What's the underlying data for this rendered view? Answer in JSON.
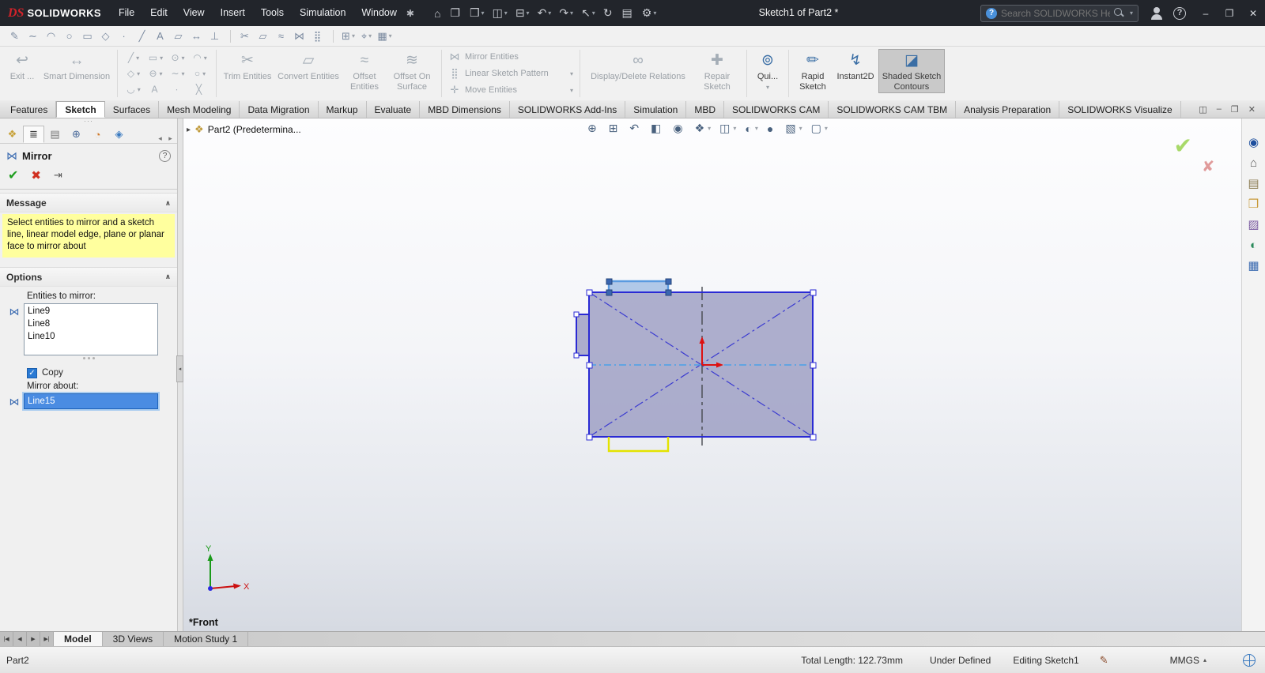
{
  "colors": {
    "titlebar_bg": "#22252b",
    "brand_red": "#d2232a",
    "message_yellow": "#ffff9e",
    "selection_blue": "#4a8ce2",
    "sketch_blue": "#2a2ad4",
    "selected_sketch_blue": "#5a9ae0",
    "preview_yellow": "#e3e300",
    "origin_red": "#dd1111",
    "shaded_fill": "#8a8cb8",
    "confirm_green": "#9fd65a",
    "cancel_red": "#e09a9a"
  },
  "ui": {
    "caret_down": "▾",
    "caret_up": "▴",
    "chevron_up": "∧",
    "grip_dots": "···",
    "collapse_left": "◂",
    "expand_right": "▸",
    "check_glyph": "✓"
  },
  "title_bar": {
    "logo_mark": "DS",
    "logo_text": "SOLIDWORKS",
    "menus": [
      "File",
      "Edit",
      "View",
      "Insert",
      "Tools",
      "Simulation",
      "Window"
    ],
    "pin_icon": "✱",
    "tools": [
      {
        "name": "home-icon",
        "glyph": "⌂"
      },
      {
        "name": "new-document-icon",
        "glyph": "❐"
      },
      {
        "name": "open-document-icon",
        "glyph": "❒",
        "caret": "▾"
      },
      {
        "name": "save-icon",
        "glyph": "◫",
        "caret": "▾"
      },
      {
        "name": "print-icon",
        "glyph": "⊟",
        "caret": "▾"
      },
      {
        "name": "undo-icon",
        "glyph": "↶",
        "caret": "▾"
      },
      {
        "name": "redo-icon",
        "glyph": "↷",
        "caret": "▾"
      },
      {
        "name": "select-icon",
        "glyph": "↖",
        "caret": "▾"
      },
      {
        "name": "rebuild-icon",
        "glyph": "↻"
      },
      {
        "name": "file-properties-icon",
        "glyph": "▤"
      },
      {
        "name": "options-icon",
        "glyph": "⚙",
        "caret": "▾"
      }
    ],
    "document_title": "Sketch1 of Part2 *",
    "search_help_glyph": "?",
    "search_placeholder": "Search SOLIDWORKS Help",
    "help_glyph": "?",
    "window_controls": [
      {
        "name": "minimize-button",
        "glyph": "–"
      },
      {
        "name": "maximize-button",
        "glyph": "❐"
      },
      {
        "name": "close-button",
        "glyph": "✕"
      }
    ]
  },
  "quick_toolbar": {
    "group1": [
      {
        "name": "sketch-tool-icon",
        "glyph": "✎"
      },
      {
        "name": "spline-tool-icon",
        "glyph": "∼"
      },
      {
        "name": "arc-tool-icon",
        "glyph": "◠"
      },
      {
        "name": "circle-tool-icon",
        "glyph": "○"
      },
      {
        "name": "rectangle-tool-icon",
        "glyph": "▭"
      },
      {
        "name": "polygon-tool-icon",
        "glyph": "◇"
      },
      {
        "name": "point-tool-icon",
        "glyph": "∙"
      },
      {
        "name": "centerline-tool-icon",
        "glyph": "╱"
      },
      {
        "name": "text-tool-icon",
        "glyph": "A"
      },
      {
        "name": "plane-tool-icon",
        "glyph": "▱"
      },
      {
        "name": "dimension-tool-icon",
        "glyph": "↔"
      },
      {
        "name": "relations-tool-icon",
        "glyph": "⊥"
      }
    ],
    "group2": [
      {
        "name": "trim-tool-icon",
        "glyph": "✂"
      },
      {
        "name": "convert-tool-icon",
        "glyph": "▱"
      },
      {
        "name": "offset-tool-icon",
        "glyph": "≈"
      },
      {
        "name": "mirror-tool-icon",
        "glyph": "⋈"
      },
      {
        "name": "pattern-tool-icon",
        "glyph": "⣿"
      }
    ],
    "group3": [
      {
        "name": "more-tools-icon",
        "glyph": "⊞",
        "caret": "▾"
      },
      {
        "name": "snap-tools-icon",
        "glyph": "⌖",
        "caret": "▾"
      },
      {
        "name": "grid-tools-icon",
        "glyph": "▦",
        "caret": "▾"
      }
    ]
  },
  "ribbon": {
    "exit_sketch": {
      "label": "Exit ...",
      "glyph": "↩"
    },
    "smart_dimension": {
      "label": "Smart Dimension",
      "glyph": "↔"
    },
    "shape_tools": [
      {
        "name": "line-icon",
        "glyph": "╱",
        "caret": "▾"
      },
      {
        "name": "rectangle-icon",
        "glyph": "▭",
        "caret": "▾"
      },
      {
        "name": "circle-icon",
        "glyph": "⊙",
        "caret": "▾"
      },
      {
        "name": "arc-icon",
        "glyph": "◠",
        "caret": "▾"
      },
      {
        "name": "polygon-icon",
        "glyph": "◇",
        "caret": "▾"
      },
      {
        "name": "slot-icon",
        "glyph": "⊖",
        "caret": "▾"
      },
      {
        "name": "spline-icon",
        "glyph": "∼",
        "caret": "▾"
      },
      {
        "name": "ellipse-icon",
        "glyph": "○",
        "caret": "▾"
      },
      {
        "name": "fillet-icon",
        "glyph": "◡",
        "caret": "▾"
      },
      {
        "name": "text-icon",
        "glyph": "A"
      },
      {
        "name": "point-icon",
        "glyph": "∙"
      },
      {
        "name": "construction-line-icon",
        "glyph": "╳"
      }
    ],
    "buttons": {
      "trim": {
        "label": "Trim Entities",
        "glyph": "✂"
      },
      "convert": {
        "label": "Convert Entities",
        "glyph": "▱"
      },
      "offset": {
        "label": "Offset Entities",
        "glyph": "≈"
      },
      "offset_surface": {
        "label": "Offset On Surface",
        "glyph": "≋"
      },
      "mirror": {
        "label": "Mirror Entities",
        "glyph": "⋈"
      },
      "linear_pattern": {
        "label": "Linear Sketch Pattern",
        "glyph": "⣿"
      },
      "move": {
        "label": "Move Entities",
        "glyph": "✛"
      },
      "display_delete": {
        "label": "Display/Delete Relations",
        "glyph": "∞"
      },
      "repair": {
        "label": "Repair Sketch",
        "glyph": "✚"
      },
      "quick_snaps": {
        "label": "Qui...",
        "glyph": "⊚"
      },
      "rapid_sketch": {
        "label": "Rapid Sketch",
        "glyph": "✏"
      },
      "instant2d": {
        "label": "Instant2D",
        "glyph": "↯"
      },
      "shaded_contours": {
        "label": "Shaded Sketch Contours",
        "glyph": "◪"
      }
    },
    "tabs": [
      {
        "label": "Features"
      },
      {
        "label": "Sketch",
        "active": true
      },
      {
        "label": "Surfaces"
      },
      {
        "label": "Mesh Modeling"
      },
      {
        "label": "Data Migration"
      },
      {
        "label": "Markup"
      },
      {
        "label": "Evaluate"
      },
      {
        "label": "MBD Dimensions"
      },
      {
        "label": "SOLIDWORKS Add-Ins"
      },
      {
        "label": "Simulation"
      },
      {
        "label": "MBD"
      },
      {
        "label": "SOLIDWORKS CAM"
      },
      {
        "label": "SOLIDWORKS CAM TBM"
      },
      {
        "label": "Analysis Preparation"
      },
      {
        "label": "SOLIDWORKS Visualize"
      }
    ],
    "doc_window_controls": [
      {
        "name": "split-view-icon",
        "glyph": "◫"
      },
      {
        "name": "doc-minimize-icon",
        "glyph": "–"
      },
      {
        "name": "doc-restore-icon",
        "glyph": "❐"
      },
      {
        "name": "doc-close-icon",
        "glyph": "✕"
      }
    ]
  },
  "property_manager": {
    "tabs": [
      {
        "name": "featuremanager-tab-icon",
        "glyph": "❖",
        "color": "#c8a23a"
      },
      {
        "name": "propertymanager-tab-icon",
        "glyph": "≣",
        "color": "#3f3f3f",
        "active": true
      },
      {
        "name": "configurationmanager-tab-icon",
        "glyph": "▤",
        "color": "#787878"
      },
      {
        "name": "dimxpertmanager-tab-icon",
        "glyph": "⊕",
        "color": "#4a6a9a"
      },
      {
        "name": "displaymanager-tab-icon",
        "glyph": "◔",
        "color": "#d07a2a"
      },
      {
        "name": "cam-tab-icon",
        "glyph": "◈",
        "color": "#3a7ac0"
      }
    ],
    "tab_scroll_left": "◂",
    "tab_scroll_right": "▸",
    "title_icon": "⋈",
    "title": "Mirror",
    "help_glyph": "?",
    "ok_icon": "✔",
    "cancel_icon": "✖",
    "pin_icon": "⇥",
    "message": {
      "header": "Message",
      "text": "Select entities to mirror and a sketch line, linear model edge, plane or planar face to mirror about"
    },
    "options": {
      "header": "Options",
      "entities_label": "Entities to mirror:",
      "entities_icon": "⋈",
      "entities": [
        "Line9",
        "Line8",
        "Line10"
      ],
      "copy_label": "Copy",
      "copy_checked": true,
      "mirror_about_label": "Mirror about:",
      "mirror_about_icon": "⋈",
      "mirror_about_value": "Line15"
    }
  },
  "viewport": {
    "part_icon": "❖",
    "feature_tree_label": "Part2 (Predetermina...",
    "toolbar": [
      {
        "name": "zoom-to-fit-icon",
        "glyph": "⊕"
      },
      {
        "name": "zoom-area-icon",
        "glyph": "⊞"
      },
      {
        "name": "previous-view-icon",
        "glyph": "↶"
      },
      {
        "name": "section-view-icon",
        "glyph": "◧"
      },
      {
        "name": "dynamic-annotation-icon",
        "glyph": "◉"
      },
      {
        "name": "view-orientation-icon",
        "glyph": "❖",
        "caret": "▾"
      },
      {
        "name": "display-style-icon",
        "glyph": "◫",
        "caret": "▾"
      },
      {
        "name": "hide-show-items-icon",
        "glyph": "◐",
        "caret": "▾"
      },
      {
        "name": "edit-appearance-icon",
        "glyph": "●"
      },
      {
        "name": "apply-scene-icon",
        "glyph": "▧",
        "caret": "▾"
      },
      {
        "name": "view-settings-icon",
        "glyph": "▢",
        "caret": "▾"
      }
    ],
    "confirm_icon": "✔",
    "cancel_icon": "✘",
    "view_label": "*Front",
    "axis_x": "X",
    "axis_y": "Y"
  },
  "task_pane": {
    "icons": [
      {
        "name": "solidworks-resources-icon",
        "glyph": "◉",
        "color": "#1d4f9e"
      },
      {
        "name": "home-icon",
        "glyph": "⌂",
        "color": "#5a5a5a"
      },
      {
        "name": "design-library-icon",
        "glyph": "▤",
        "color": "#8a7a50"
      },
      {
        "name": "file-explorer-icon",
        "glyph": "❒",
        "color": "#c89a3a"
      },
      {
        "name": "view-palette-icon",
        "glyph": "▨",
        "color": "#7a5aa0"
      },
      {
        "name": "appearances-icon",
        "glyph": "◐",
        "color": "#2a8a5a"
      },
      {
        "name": "custom-properties-icon",
        "glyph": "▦",
        "color": "#3a6ab0"
      }
    ]
  },
  "bottom_bar": {
    "nav_buttons": [
      {
        "name": "first-tab-icon",
        "glyph": "|◀"
      },
      {
        "name": "prev-tab-icon",
        "glyph": "◀"
      },
      {
        "name": "next-tab-icon",
        "glyph": "▶"
      },
      {
        "name": "last-tab-icon",
        "glyph": "▶|"
      }
    ],
    "tabs": [
      {
        "label": "Model",
        "active": true
      },
      {
        "label": "3D Views"
      },
      {
        "label": "Motion Study 1"
      }
    ]
  },
  "status_bar": {
    "document_name": "Part2",
    "total_length": "Total Length: 122.73mm",
    "definition_state": "Under Defined",
    "editing_label": "Editing Sketch1",
    "sketch_icon": "✎",
    "unit_system": "MMGS",
    "unit_caret": "▴"
  }
}
